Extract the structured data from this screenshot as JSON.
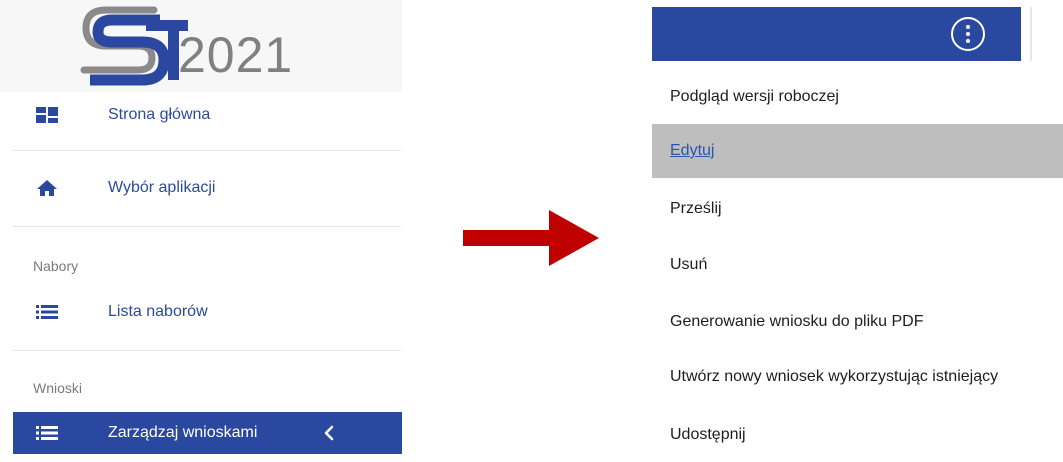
{
  "logo": {
    "letters": "ST",
    "year": "2021"
  },
  "sidebar": {
    "items": [
      {
        "label": "Strona główna",
        "icon": "dashboard-icon"
      },
      {
        "label": "Wybór aplikacji",
        "icon": "home-icon"
      }
    ],
    "sections": [
      {
        "title": "Nabory",
        "items": [
          {
            "label": "Lista naborów",
            "icon": "list-icon"
          }
        ]
      },
      {
        "title": "Wnioski",
        "items": [
          {
            "label": "Zarządzaj wnioskami",
            "icon": "list-icon",
            "active": true,
            "trailing_icon": "chevron-left-icon"
          }
        ]
      }
    ]
  },
  "arrow": {
    "icon": "right-arrow-icon",
    "color": "#c00000"
  },
  "menu": {
    "kebab_icon": "more-vertical-icon",
    "items": [
      "Podgląd wersji roboczej",
      "Edytuj",
      "Prześlij",
      "Usuń",
      "Generowanie wniosku do pliku PDF",
      "Utwórz nowy wniosek wykorzystując istniejący",
      "Udostępnij"
    ],
    "highlighted_item": "Edytuj"
  },
  "colors": {
    "primary": "#2b48a0",
    "link": "#2f52b3",
    "highlight": "#bebebe"
  }
}
